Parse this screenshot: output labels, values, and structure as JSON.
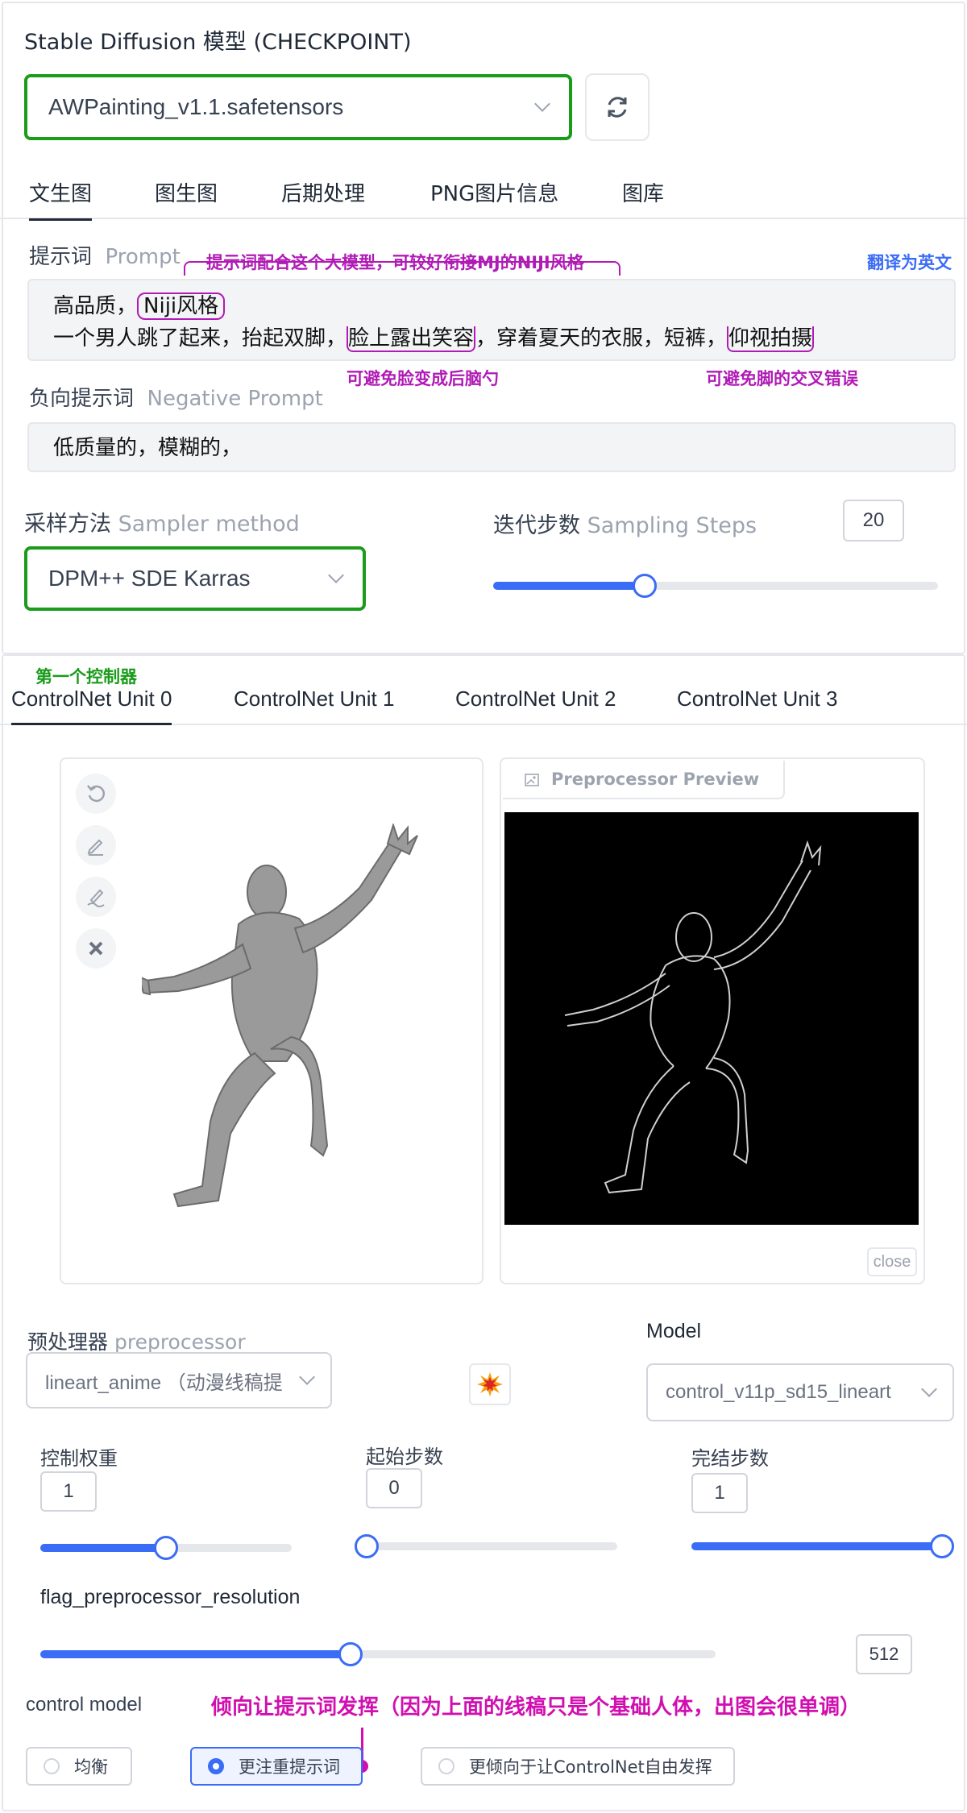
{
  "checkpoint": {
    "label": "Stable Diffusion 模型 (CHECKPOINT)",
    "selected": "AWPainting_v1.1.safetensors"
  },
  "main_tabs": [
    "文生图",
    "图生图",
    "后期处理",
    "PNG图片信息",
    "图库"
  ],
  "prompt": {
    "label_cn": "提示词",
    "label_en": "Prompt",
    "translate": "翻译为英文",
    "line1_prefix": "高品质，",
    "line1_highlight": "Niji风格",
    "line2_a": "一个男人跳了起来，抬起双脚，",
    "line2_b": "脸上露出笑容",
    "line2_c": "，穿着夏天的衣服，短裤，",
    "line2_d": "仰视拍摄",
    "ann_model": "提示词配合这个大模型，可较好衔接MJ的NIJI风格",
    "ann_face": "可避免脸变成后脑勺",
    "ann_feet": "可避免脚的交叉错误"
  },
  "negative": {
    "label_cn": "负向提示词",
    "label_en": "Negative Prompt",
    "text": "低质量的，模糊的，"
  },
  "sampler": {
    "label_cn": "采样方法",
    "label_en": "Sampler method",
    "selected": "DPM++ SDE Karras"
  },
  "steps": {
    "label_cn": "迭代步数",
    "label_en": "Sampling Steps",
    "value": "20",
    "fraction": 0.34
  },
  "controlnet": {
    "first_annotation": "第一个控制器",
    "tabs": [
      "ControlNet Unit 0",
      "ControlNet Unit 1",
      "ControlNet Unit 2",
      "ControlNet Unit 3"
    ],
    "preview_label": "Preprocessor Preview",
    "close": "close",
    "preprocessor_label_cn": "预处理器",
    "preprocessor_label_en": "preprocessor",
    "preprocessor_value": "lineart_anime （动漫线稿提",
    "model_label": "Model",
    "model_value": "control_v11p_sd15_lineart",
    "weight_label": "控制权重",
    "weight_value": "1",
    "weight_fraction": 0.5,
    "start_label": "起始步数",
    "start_value": "0",
    "start_fraction": 0.0,
    "end_label": "完结步数",
    "end_value": "1",
    "end_fraction": 1.0,
    "resolution_label": "flag_preprocessor_resolution",
    "resolution_value": "512",
    "resolution_fraction": 0.46,
    "control_mode_label": "control model",
    "control_mode_annotation": "倾向让提示词发挥（因为上面的线稿只是个基础人体，出图会很单调）",
    "control_modes": [
      "均衡",
      "更注重提示词",
      "更倾向于让ControlNet自由发挥"
    ],
    "selected_mode": "更注重提示词"
  },
  "colors": {
    "accent": "#3b6cf6",
    "highlight_green": "#1a9b1a",
    "annotation_purple": "#b01bb5",
    "annotation_magenta": "#d10fb0",
    "annotation_green": "#1a9b1a"
  }
}
